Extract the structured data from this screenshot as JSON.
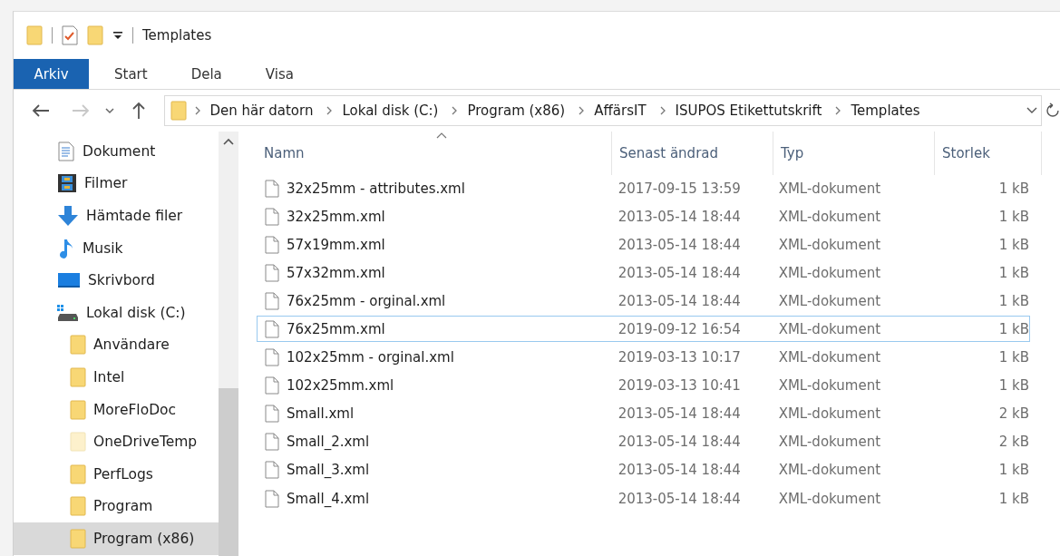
{
  "window": {
    "title": "Templates"
  },
  "ribbon_tabs": [
    {
      "label": "Arkiv",
      "selected": true
    },
    {
      "label": "Start",
      "selected": false
    },
    {
      "label": "Dela",
      "selected": false
    },
    {
      "label": "Visa",
      "selected": false
    }
  ],
  "breadcrumb": [
    "Den här datorn",
    "Lokal disk (C:)",
    "Program (x86)",
    "AffärsIT",
    "ISUPOS Etikettutskrift",
    "Templates"
  ],
  "sidebar": {
    "items": [
      {
        "kind": "document",
        "label": "Dokument",
        "selected": false
      },
      {
        "kind": "video",
        "label": "Filmer",
        "selected": false
      },
      {
        "kind": "download",
        "label": "Hämtade filer",
        "selected": false
      },
      {
        "kind": "music",
        "label": "Musik",
        "selected": false
      },
      {
        "kind": "desktop",
        "label": "Skrivbord",
        "selected": false
      },
      {
        "kind": "drive",
        "label": "Lokal disk (C:)",
        "selected": false,
        "children": [
          {
            "kind": "folder",
            "label": "Användare",
            "selected": false,
            "hidden": false
          },
          {
            "kind": "folder",
            "label": "Intel",
            "selected": false,
            "hidden": false
          },
          {
            "kind": "folder",
            "label": "MoreFloDoc",
            "selected": false,
            "hidden": false
          },
          {
            "kind": "folder",
            "label": "OneDriveTemp",
            "selected": false,
            "hidden": true
          },
          {
            "kind": "folder",
            "label": "PerfLogs",
            "selected": false,
            "hidden": false
          },
          {
            "kind": "folder",
            "label": "Program",
            "selected": false,
            "hidden": false
          },
          {
            "kind": "folder",
            "label": "Program (x86)",
            "selected": true,
            "hidden": false
          }
        ]
      }
    ]
  },
  "table": {
    "columns": [
      "Namn",
      "Senast ändrad",
      "Typ",
      "Storlek"
    ],
    "rows": [
      {
        "name": "32x25mm - attributes.xml",
        "modified": "2017-09-15 13:59",
        "type": "XML-dokument",
        "size": "1 kB",
        "focused": false
      },
      {
        "name": "32x25mm.xml",
        "modified": "2013-05-14 18:44",
        "type": "XML-dokument",
        "size": "1 kB",
        "focused": false
      },
      {
        "name": "57x19mm.xml",
        "modified": "2013-05-14 18:44",
        "type": "XML-dokument",
        "size": "1 kB",
        "focused": false
      },
      {
        "name": "57x32mm.xml",
        "modified": "2013-05-14 18:44",
        "type": "XML-dokument",
        "size": "1 kB",
        "focused": false
      },
      {
        "name": "76x25mm - orginal.xml",
        "modified": "2013-05-14 18:44",
        "type": "XML-dokument",
        "size": "1 kB",
        "focused": false
      },
      {
        "name": "76x25mm.xml",
        "modified": "2019-09-12 16:54",
        "type": "XML-dokument",
        "size": "1 kB",
        "focused": true
      },
      {
        "name": "102x25mm - orginal.xml",
        "modified": "2019-03-13 10:17",
        "type": "XML-dokument",
        "size": "1 kB",
        "focused": false
      },
      {
        "name": "102x25mm.xml",
        "modified": "2019-03-13 10:41",
        "type": "XML-dokument",
        "size": "1 kB",
        "focused": false
      },
      {
        "name": "Small.xml",
        "modified": "2013-05-14 18:44",
        "type": "XML-dokument",
        "size": "2 kB",
        "focused": false
      },
      {
        "name": "Small_2.xml",
        "modified": "2013-05-14 18:44",
        "type": "XML-dokument",
        "size": "2 kB",
        "focused": false
      },
      {
        "name": "Small_3.xml",
        "modified": "2013-05-14 18:44",
        "type": "XML-dokument",
        "size": "1 kB",
        "focused": false
      },
      {
        "name": "Small_4.xml",
        "modified": "2013-05-14 18:44",
        "type": "XML-dokument",
        "size": "1 kB",
        "focused": false
      }
    ]
  }
}
